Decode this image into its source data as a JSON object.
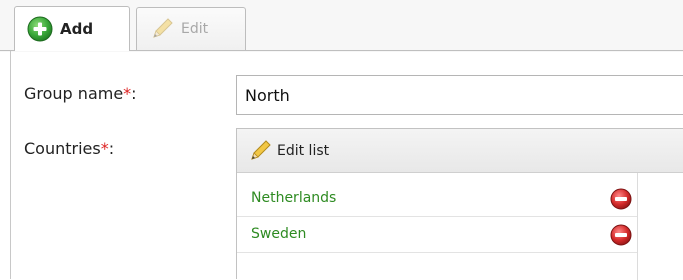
{
  "tabs": {
    "add_label": "Add",
    "edit_label": "Edit"
  },
  "form": {
    "group_name_label": "Group name",
    "countries_label": "Countries",
    "required_marker": "*",
    "label_suffix": ":",
    "group_name_value": "North"
  },
  "list": {
    "edit_list_label": "Edit list",
    "items": [
      {
        "name": "Netherlands"
      },
      {
        "name": "Sweden"
      }
    ]
  },
  "colors": {
    "country_text": "#2e8b22",
    "required": "#dd2222",
    "add_icon": "#3aa83a",
    "remove_icon": "#d42a2a"
  },
  "icons": {
    "add_tab": "plus-circle-icon",
    "edit_tab": "pencil-icon",
    "edit_list": "pencil-icon",
    "remove": "minus-circle-icon"
  }
}
